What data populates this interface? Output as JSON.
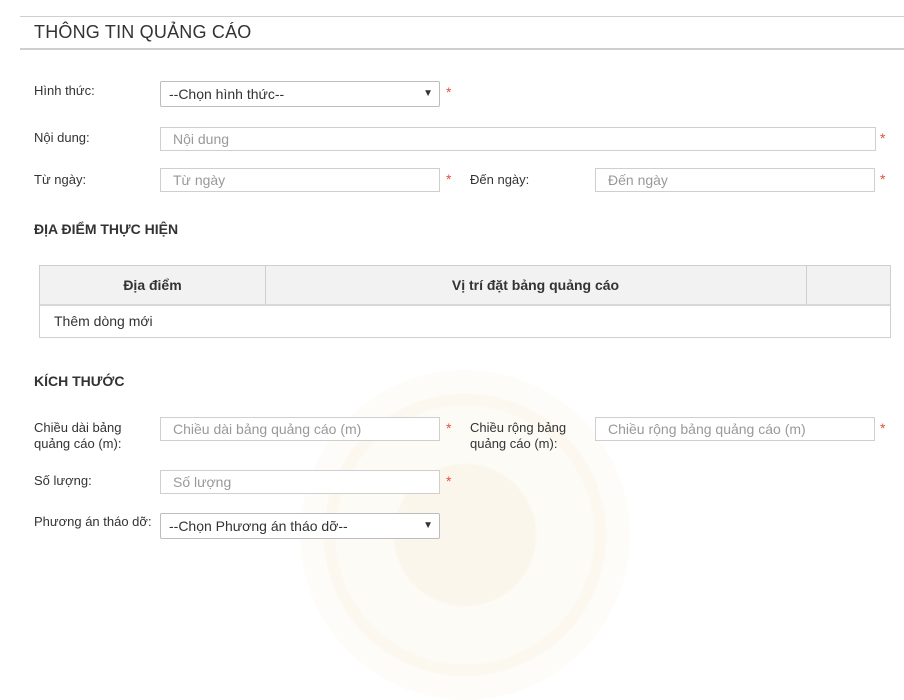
{
  "section": {
    "title": "THÔNG TIN QUẢNG CÁO"
  },
  "form": {
    "hinh_thuc": {
      "label": "Hình thức:",
      "value": "--Chọn hình thức--"
    },
    "noi_dung": {
      "label": "Nội dung:",
      "placeholder": "Nội dung"
    },
    "tu_ngay": {
      "label": "Từ ngày:",
      "placeholder": "Từ ngày"
    },
    "den_ngay": {
      "label": "Đến ngày:",
      "placeholder": "Đến ngày"
    },
    "required_mark": "*"
  },
  "location": {
    "heading": "ĐỊA ĐIỂM THỰC HIỆN",
    "columns": [
      "Địa điểm",
      "Vị trí đặt bảng quảng cáo",
      ""
    ],
    "add_row": "Thêm dòng mới"
  },
  "size": {
    "heading": "KÍCH THƯỚC",
    "length": {
      "label_line1": "Chiều dài bảng",
      "label_line2": "quảng cáo (m):",
      "placeholder": "Chiều dài bảng quảng cáo (m)"
    },
    "width": {
      "label_line1": "Chiều rộng bảng",
      "label_line2": "quảng cáo (m):",
      "placeholder": "Chiều rộng bảng quảng cáo (m)"
    },
    "quantity": {
      "label": "Số lượng:",
      "placeholder": "Số lượng"
    },
    "removal": {
      "label": "Phương án tháo dỡ:",
      "value": "--Chọn Phương án tháo dỡ--"
    }
  },
  "colors": {
    "required": "#e2513a",
    "border": "#cfcfcf",
    "header_bg": "#f2f2f2"
  }
}
